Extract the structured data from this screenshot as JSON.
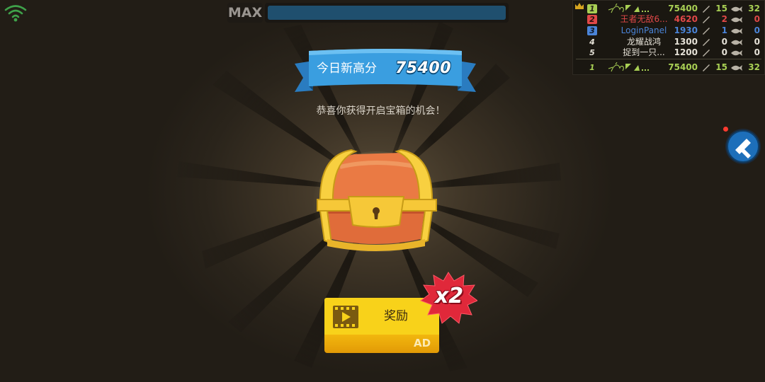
{
  "colors": {
    "accent_blue": "#3a9ee0",
    "ribbon_dark": "#1f6aa6",
    "button_yellow": "#f8d21a",
    "x2_red": "#e0283a",
    "leaderboard_green": "#a8cf54",
    "leaderboard_red": "#e04848",
    "leaderboard_blue": "#4a84d8",
    "leaderboard_white": "#e6e2d8"
  },
  "hud": {
    "max_label": "MAX",
    "wifi_icon": "wifi-icon"
  },
  "leaderboard": {
    "rows": [
      {
        "rank": "1",
        "name": "",
        "score": "75400",
        "kills": "15",
        "deaths": "32"
      },
      {
        "rank": "2",
        "name": "王者无敌6...",
        "score": "4620",
        "kills": "2",
        "deaths": "0"
      },
      {
        "rank": "3",
        "name": "LoginPanel",
        "score": "1930",
        "kills": "1",
        "deaths": "0"
      },
      {
        "rank": "4",
        "name": "龙耀战鸿",
        "score": "1300",
        "kills": "0",
        "deaths": "0"
      },
      {
        "rank": "5",
        "name": "捉到一只...",
        "score": "1200",
        "kills": "0",
        "deaths": "0"
      }
    ],
    "self": {
      "rank": "1",
      "name": "",
      "score": "75400",
      "kills": "15",
      "deaths": "32"
    }
  },
  "result": {
    "new_high_label": "今日新高分",
    "score": "75400",
    "congrats": "恭喜你获得开启宝箱的机会！"
  },
  "reward_button": {
    "label": "奖励",
    "ad_label": "AD",
    "multiplier": "x2"
  }
}
